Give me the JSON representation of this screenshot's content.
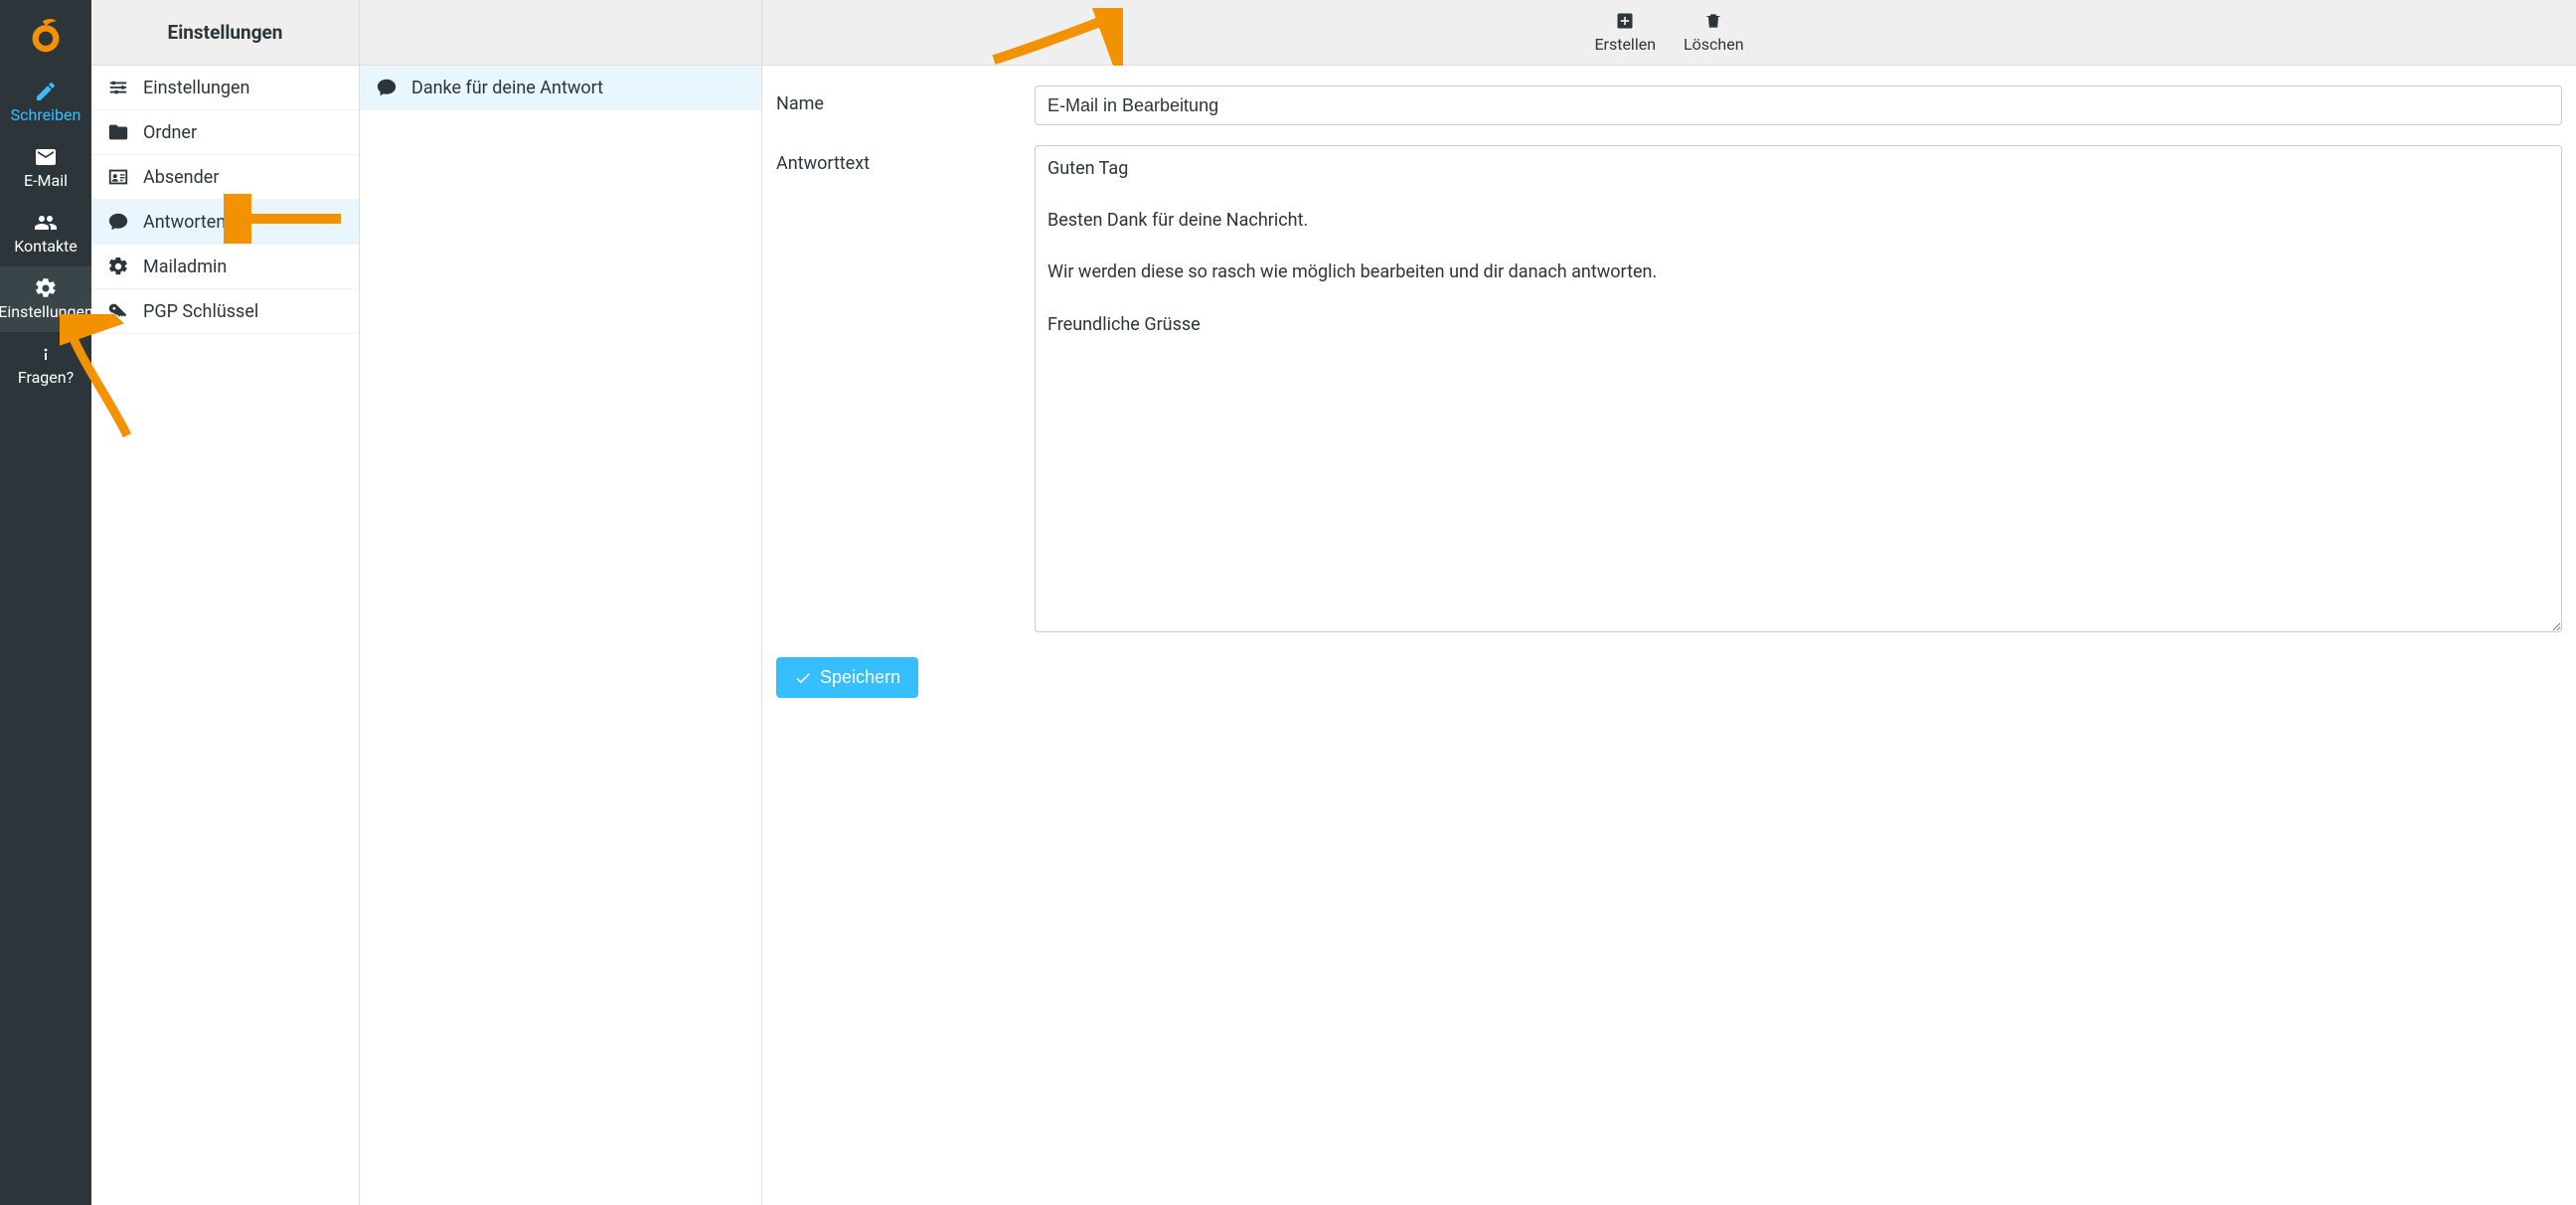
{
  "nav": {
    "items": [
      {
        "label": "Schreiben"
      },
      {
        "label": "E-Mail"
      },
      {
        "label": "Kontakte"
      },
      {
        "label": "Einstellungen"
      },
      {
        "label": "Fragen?"
      }
    ]
  },
  "settings_panel": {
    "title": "Einstellungen",
    "items": [
      {
        "label": "Einstellungen"
      },
      {
        "label": "Ordner"
      },
      {
        "label": "Absender"
      },
      {
        "label": "Antworten"
      },
      {
        "label": "Mailadmin"
      },
      {
        "label": "PGP Schlüssel"
      }
    ]
  },
  "replies_panel": {
    "items": [
      {
        "label": "Danke für deine Antwort"
      }
    ]
  },
  "toolbar": {
    "create_label": "Erstellen",
    "delete_label": "Löschen"
  },
  "form": {
    "name_label": "Name",
    "name_value": "E-Mail in Bearbeitung",
    "body_label": "Antworttext",
    "body_value": "Guten Tag\n\nBesten Dank für deine Nachricht.\n\nWir werden diese so rasch wie möglich bearbeiten und dir danach antworten.\n\nFreundliche Grüsse",
    "save_label": "Speichern"
  },
  "colors": {
    "accent_blue": "#37beff",
    "accent_orange": "#f39200",
    "dark_bg": "#2c363a"
  }
}
